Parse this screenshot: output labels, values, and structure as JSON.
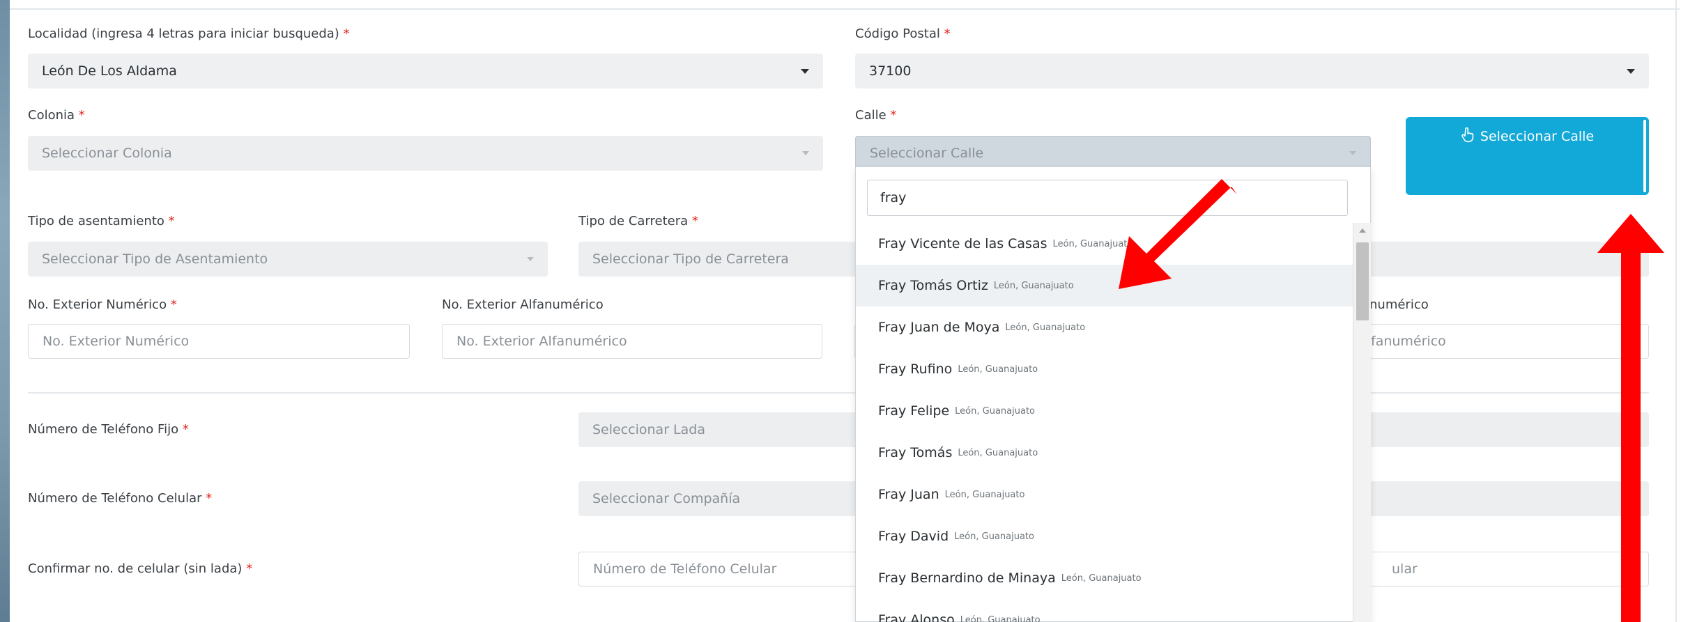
{
  "form": {
    "localidad": {
      "label": "Localidad (ingresa 4 letras para iniciar busqueda)",
      "required": "*",
      "value": "León De Los Aldama"
    },
    "codigo_postal": {
      "label": "Código Postal",
      "required": "*",
      "value": "37100"
    },
    "colonia": {
      "label": "Colonia",
      "required": "*",
      "placeholder": "Seleccionar Colonia"
    },
    "calle": {
      "label": "Calle",
      "required": "*",
      "placeholder": "Seleccionar Calle"
    },
    "seleccionar_calle_button": {
      "label": "Seleccionar Calle",
      "icon": "hand-pointer-icon"
    },
    "tipo_asentamiento": {
      "label": "Tipo de asentamiento",
      "required": "*",
      "placeholder": "Seleccionar Tipo de Asentamiento"
    },
    "tipo_carretera": {
      "label": "Tipo de Carretera",
      "required": "*",
      "placeholder": "Seleccionar Tipo de Carretera"
    },
    "no_exterior_numerico": {
      "label": "No. Exterior Numérico",
      "required": "*",
      "placeholder": "No. Exterior Numérico"
    },
    "no_exterior_alfanumerico": {
      "label": "No. Exterior Alfanumérico",
      "placeholder": "No. Exterior Alfanumérico"
    },
    "no_interior_alfanumerico": {
      "label_fragment": "numérico",
      "placeholder_fragment": "fanumérico"
    },
    "telefono_fijo": {
      "label": "Número de Teléfono Fijo",
      "required": "*",
      "placeholder": "Seleccionar Lada"
    },
    "telefono_celular": {
      "label": "Número de Teléfono Celular",
      "required": "*",
      "placeholder": "Seleccionar Compañía"
    },
    "confirmar_celular": {
      "label": "Confirmar no. de celular (sin lada)",
      "required": "*",
      "placeholder": "Número de Teléfono Celular",
      "right_fragment": "ular"
    }
  },
  "dropdown": {
    "search_value": "fray",
    "items": [
      {
        "name": "Fray Vicente de las Casas",
        "sub": "León, Guanajuato"
      },
      {
        "name": "Fray Tomás Ortiz",
        "sub": "León, Guanajuato"
      },
      {
        "name": "Fray Juan de Moya",
        "sub": "León, Guanajuato"
      },
      {
        "name": "Fray Rufino",
        "sub": "León, Guanajuato"
      },
      {
        "name": "Fray Felipe",
        "sub": "León, Guanajuato"
      },
      {
        "name": "Fray Tomás",
        "sub": "León, Guanajuato"
      },
      {
        "name": "Fray Juan",
        "sub": "León, Guanajuato"
      },
      {
        "name": "Fray David",
        "sub": "León, Guanajuato"
      },
      {
        "name": "Fray Bernardino de Minaya",
        "sub": "León, Guanajuato"
      },
      {
        "name": "Fray Alonso",
        "sub": "León, Guanajuato"
      }
    ]
  },
  "colors": {
    "accent": "#12a8d8",
    "required": "#e2231a",
    "annotation_arrow": "#ff0000"
  }
}
